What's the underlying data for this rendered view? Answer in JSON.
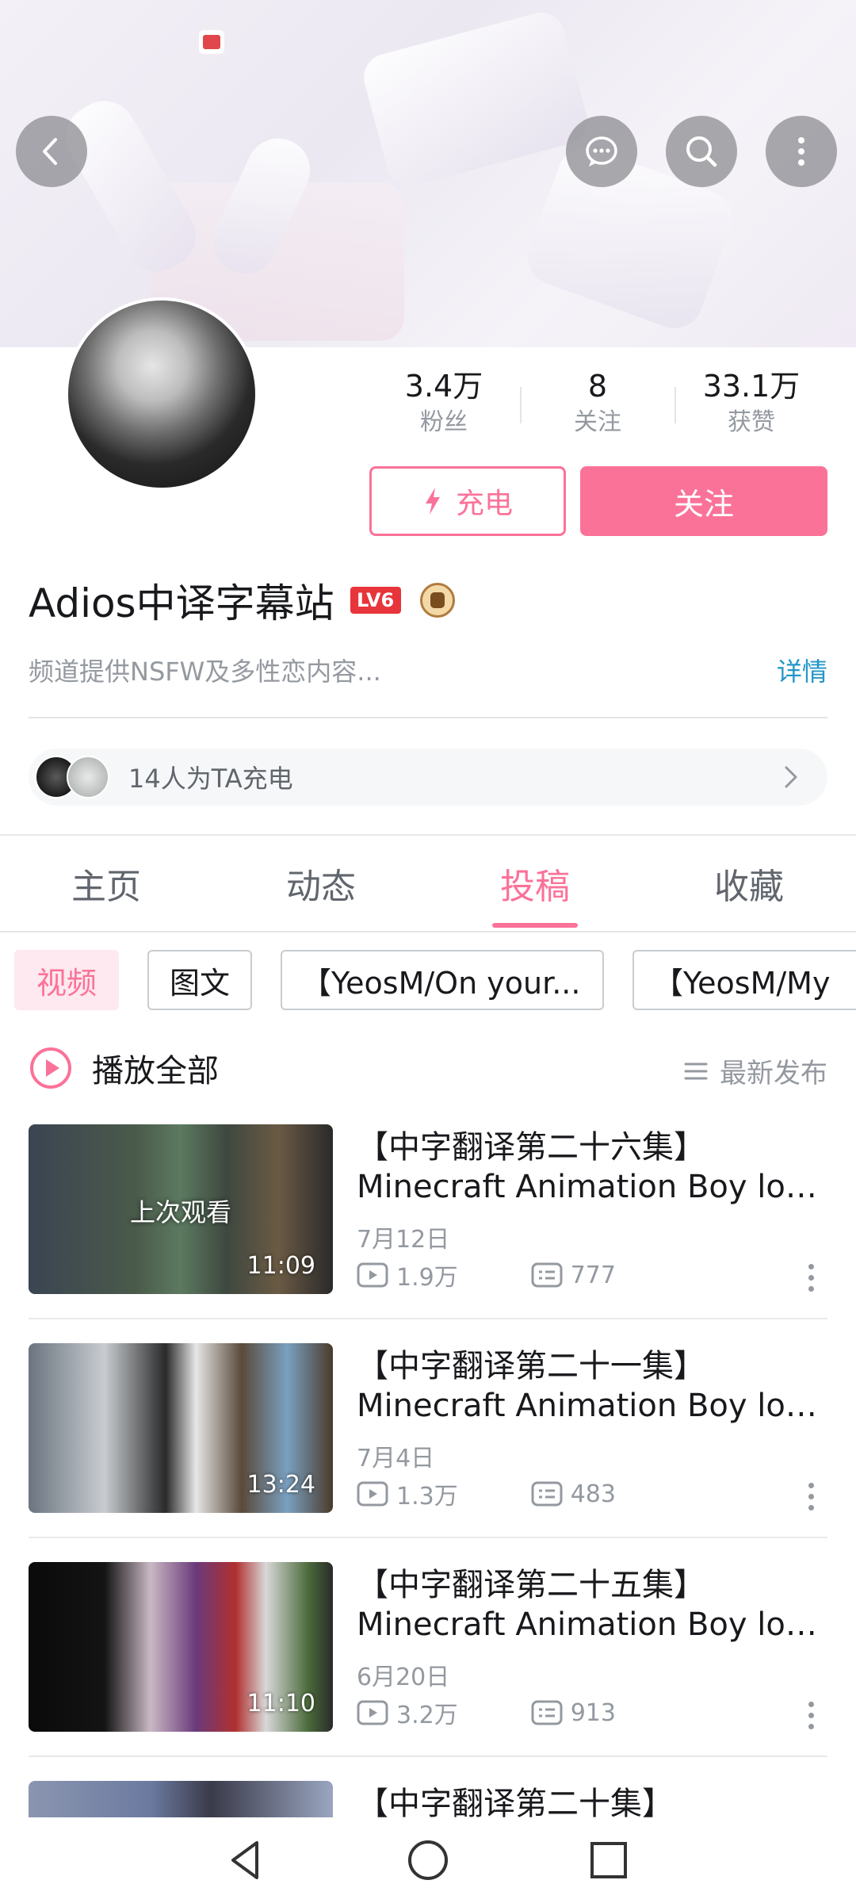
{
  "banner": {
    "back_icon": "chevron-left-icon",
    "message_icon": "chat-bubble-icon",
    "search_icon": "search-icon",
    "more_icon": "more-vertical-icon"
  },
  "profile": {
    "name": "Adios中译字幕站",
    "level_badge": "LV6",
    "sign": "频道提供NSFW及多性恋内容...",
    "detail_link": "详情",
    "stats": [
      {
        "value": "3.4万",
        "label": "粉丝"
      },
      {
        "value": "8",
        "label": "关注"
      },
      {
        "value": "33.1万",
        "label": "获赞"
      }
    ],
    "charge_button": "充电",
    "follow_button": "关注",
    "charge_summary": "14人为TA充电"
  },
  "tabs": [
    "主页",
    "动态",
    "投稿",
    "收藏"
  ],
  "active_tab": "投稿",
  "chips": [
    "视频",
    "图文",
    "【YeosM/On your...",
    "【YeosM/My"
  ],
  "play_all": "播放全部",
  "sort_label": "最新发布",
  "videos": [
    {
      "title1": "【中字翻译第二十六集】",
      "title2": "Minecraft Animation Boy love/...",
      "date": "7月12日",
      "views": "1.9万",
      "comments": "777",
      "duration": "11:09",
      "overlay": "上次观看"
    },
    {
      "title1": "【中字翻译第二十一集】",
      "title2": "Minecraft Animation Boy love/...",
      "date": "7月4日",
      "views": "1.3万",
      "comments": "483",
      "duration": "13:24"
    },
    {
      "title1": "【中字翻译第二十五集】",
      "title2": "Minecraft Animation Boy love/...",
      "date": "6月20日",
      "views": "3.2万",
      "comments": "913",
      "duration": "11:10"
    },
    {
      "title1": "【中字翻译第二十集】"
    }
  ],
  "colors": {
    "accent": "#fb7299",
    "link": "#2296c8",
    "muted": "#9499a0"
  }
}
